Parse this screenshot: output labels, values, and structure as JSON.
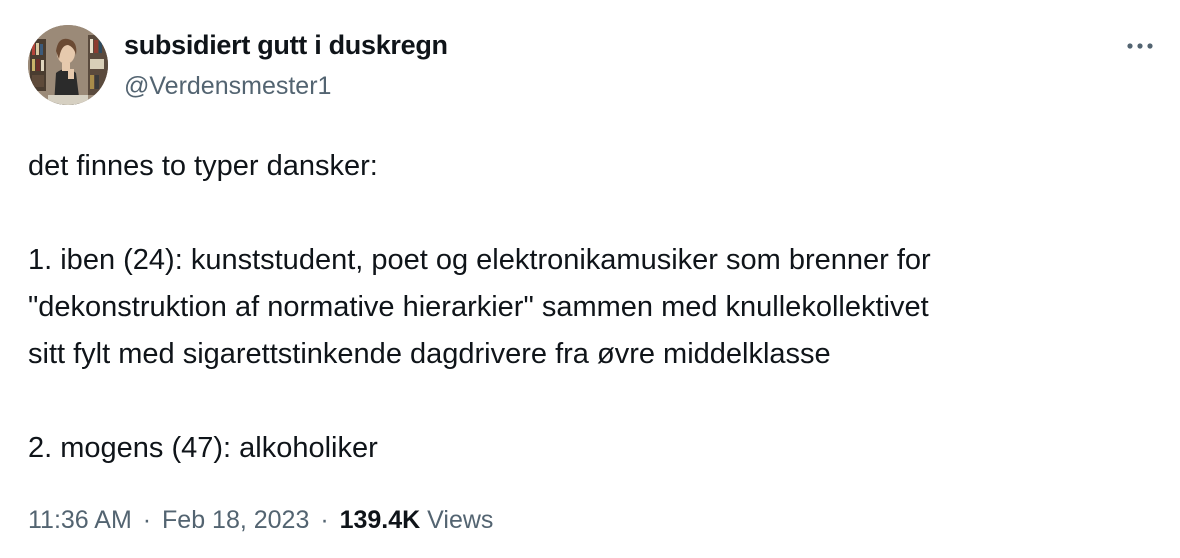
{
  "author": {
    "display_name": "subsidiert gutt i duskregn",
    "handle": "@Verdensmester1"
  },
  "icons": {
    "more": "more-options-icon",
    "avatar": "profile-avatar"
  },
  "tweet": {
    "lines": [
      "det finnes to typer dansker:",
      "",
      "1. iben (24): kunststudent, poet og elektronikamusiker som brenner for",
      "\"dekonstruktion af normative hierarkier\" sammen med knullekollektivet",
      "sitt fylt med sigarettstinkende dagdrivere fra øvre middelklasse",
      "",
      "2. mogens (47): alkoholiker"
    ]
  },
  "meta": {
    "time": "11:36 AM",
    "separator": "·",
    "date": "Feb 18, 2023",
    "views_count": "139.4K",
    "views_label": "Views"
  },
  "colors": {
    "text_primary": "#0f1419",
    "text_secondary": "#536471"
  }
}
